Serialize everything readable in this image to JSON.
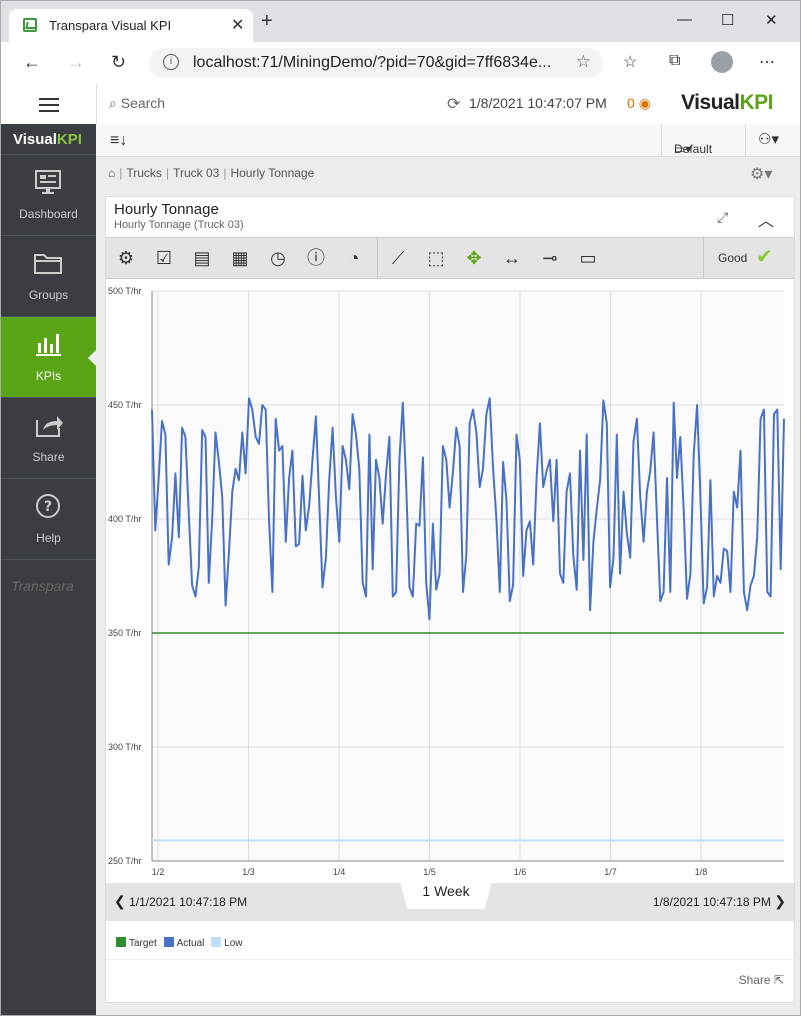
{
  "browser": {
    "tab_title": "Transpara Visual KPI",
    "url": "localhost:71/MiningDemo/?pid=70&gid=7ff6834e..."
  },
  "header": {
    "search_placeholder": "Search",
    "timestamp": "1/8/2021 10:47:07 PM",
    "alarm_count": "0",
    "brand_prefix": "Visual",
    "brand_suffix": "KPI"
  },
  "sidebar": {
    "brand_prefix": "Visual",
    "brand_suffix": "KPI",
    "items": [
      {
        "label": "Dashboard"
      },
      {
        "label": "Groups"
      },
      {
        "label": "KPIs"
      },
      {
        "label": "Share"
      },
      {
        "label": "Help"
      }
    ],
    "footer": "Transpara"
  },
  "toolbar": {
    "layout": "Default"
  },
  "breadcrumb": {
    "items": [
      "Trucks",
      "Truck 03",
      "Hourly Tonnage"
    ]
  },
  "panel": {
    "title": "Hourly Tonnage",
    "subtitle": "Hourly Tonnage (Truck 03)",
    "status": "Good"
  },
  "range": {
    "start": "1/1/2021 10:47:18 PM",
    "end": "1/8/2021 10:47:18 PM",
    "label": "1 Week"
  },
  "legend": [
    "Target",
    "Actual",
    "Low"
  ],
  "share_label": "Share",
  "colors": {
    "target": "#2e8b2e",
    "actual": "#4a72c4",
    "low": "#bfe0f7",
    "accent": "#5aa516"
  },
  "chart_data": {
    "type": "line",
    "ylim": [
      250,
      500
    ],
    "y_ticks": [
      "250 T/hr",
      "300 T/hr",
      "350 T/hr",
      "400 T/hr",
      "450 T/hr",
      "500 T/hr"
    ],
    "x_ticks": [
      "1/2",
      "1/3",
      "1/4",
      "1/5",
      "1/6",
      "1/7",
      "1/8"
    ],
    "series": [
      {
        "name": "Target",
        "values": [
          350
        ]
      },
      {
        "name": "Low",
        "values": [
          259
        ]
      },
      {
        "name": "Actual",
        "values": [
          448,
          395,
          418,
          443,
          437,
          380,
          392,
          420,
          392,
          440,
          436,
          402,
          371,
          366,
          379,
          439,
          436,
          372,
          400,
          438,
          425,
          410,
          362,
          385,
          412,
          422,
          417,
          438,
          420,
          453,
          448,
          436,
          433,
          450,
          448,
          400,
          368,
          444,
          430,
          432,
          390,
          418,
          430,
          388,
          389,
          419,
          395,
          406,
          426,
          445,
          408,
          370,
          383,
          417,
          440,
          410,
          390,
          432,
          426,
          413,
          446,
          437,
          422,
          372,
          366,
          437,
          378,
          426,
          418,
          398,
          420,
          436,
          366,
          368,
          426,
          451,
          416,
          370,
          366,
          398,
          397,
          427,
          372,
          356,
          398,
          369,
          376,
          432,
          426,
          405,
          421,
          440,
          432,
          368,
          384,
          442,
          448,
          438,
          414,
          422,
          446,
          453,
          422,
          400,
          368,
          425,
          408,
          364,
          371,
          437,
          426,
          375,
          395,
          399,
          380,
          418,
          442,
          414,
          421,
          426,
          399,
          426,
          376,
          372,
          412,
          420,
          384,
          369,
          430,
          382,
          437,
          360,
          390,
          404,
          417,
          452,
          442,
          370,
          383,
          437,
          376,
          412,
          394,
          383,
          434,
          444,
          410,
          390,
          412,
          421,
          438,
          401,
          364,
          368,
          418,
          368,
          451,
          418,
          436,
          404,
          365,
          376,
          428,
          450,
          410,
          363,
          370,
          417,
          366,
          375,
          372,
          387,
          386,
          368,
          412,
          405,
          430,
          368,
          360,
          371,
          375,
          392,
          444,
          448,
          368,
          366,
          446,
          448,
          378,
          444
        ]
      }
    ]
  }
}
